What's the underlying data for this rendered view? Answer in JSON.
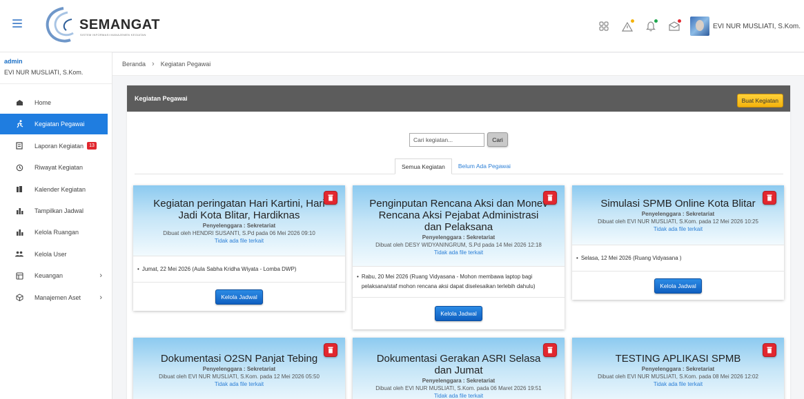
{
  "header": {
    "logo_text": "SEMANGAT",
    "logo_subtitle": "SISTEM INFORMASI MANAJEMEN KEGIATAN",
    "user_name": "EVI NUR MUSLIATI, S.Kom."
  },
  "sidebar": {
    "role": "admin",
    "user_name": "EVI NUR MUSLIATI, S.Kom.",
    "items": [
      {
        "label": "Home",
        "icon": "home-icon"
      },
      {
        "label": "Kegiatan Pegawai",
        "icon": "run-icon"
      },
      {
        "label": "Laporan Kegiatan",
        "icon": "report-icon",
        "badge": "13"
      },
      {
        "label": "Riwayat Kegiatan",
        "icon": "history-icon"
      },
      {
        "label": "Kalender Kegiatan",
        "icon": "calendar-icon"
      },
      {
        "label": "Tampilkan Jadwal",
        "icon": "bar-chart-icon"
      },
      {
        "label": "Kelola Ruangan",
        "icon": "bar-chart-icon"
      },
      {
        "label": "Kelola User",
        "icon": "users-icon"
      },
      {
        "label": "Keuangan",
        "icon": "table-icon"
      },
      {
        "label": "Manajemen Aset",
        "icon": "box-icon"
      }
    ]
  },
  "breadcrumb": {
    "home": "Beranda",
    "current": "Kegiatan Pegawai"
  },
  "panel": {
    "title": "Kegiatan Pegawai",
    "create_button": "Buat Kegiatan",
    "search_placeholder": "Cari kegiatan...",
    "search_button": "Cari",
    "tabs": [
      "Semua Kegiatan",
      "Belum Ada Pegawai"
    ]
  },
  "cards": [
    {
      "title": "Kegiatan peringatan Hari Kartini, Hari Jadi Kota Blitar, Hardiknas",
      "organizer": "Penyelenggara : Sekretariat",
      "created_by": "Dibuat oleh HENDRI SUSANTI, S.Pd pada 06 Mei 2026 09:10",
      "file": "Tidak ada file terkait",
      "schedule": "Jumat, 22 Mei 2026 (Aula Sabha Kridha Wiyata - Lomba DWP)",
      "button": "Kelola Jadwal"
    },
    {
      "title": "Penginputan Rencana Aksi dan Monev Rencana Aksi Pejabat Administrasi dan Pelaksana",
      "organizer": "Penyelenggara : Sekretariat",
      "created_by": "Dibuat oleh DESY WIDYANINGRUM, S.Pd pada 14 Mei 2026 12:18",
      "file": "Tidak ada file terkait",
      "schedule": "Rabu, 20 Mei 2026 (Ruang Vidyasana - Mohon membawa laptop bagi pelaksana/staf mohon rencana aksi dapat diselesaikan terlebih dahulu)",
      "button": "Kelola Jadwal"
    },
    {
      "title": "Simulasi SPMB Online Kota Blitar",
      "organizer": "Penyelenggara : Sekretariat",
      "created_by": "Dibuat oleh EVI NUR MUSLIATI, S.Kom. pada 12 Mei 2026 10:25",
      "file": "Tidak ada file terkait",
      "schedule": "Selasa, 12 Mei 2026 (Ruang Vidyasana )",
      "button": "Kelola Jadwal"
    },
    {
      "title": "Dokumentasi O2SN Panjat Tebing",
      "organizer": "Penyelenggara : Sekretariat",
      "created_by": "Dibuat oleh EVI NUR MUSLIATI, S.Kom. pada 12 Mei 2026 05:50",
      "file": "Tidak ada file terkait"
    },
    {
      "title": "Dokumentasi Gerakan ASRI Selasa dan Jumat",
      "organizer": "Penyelenggara : Sekretariat",
      "created_by": "Dibuat oleh EVI NUR MUSLIATI, S.Kom. pada 06 Maret 2026 19:51",
      "file": "Tidak ada file terkait"
    },
    {
      "title": "TESTING APLIKASI SPMB",
      "organizer": "Penyelenggara : Sekretariat",
      "created_by": "Dibuat oleh EVI NUR MUSLIATI, S.Kom. pada 08 Mei 2026 12:02",
      "file": "Tidak ada file terkait"
    }
  ]
}
